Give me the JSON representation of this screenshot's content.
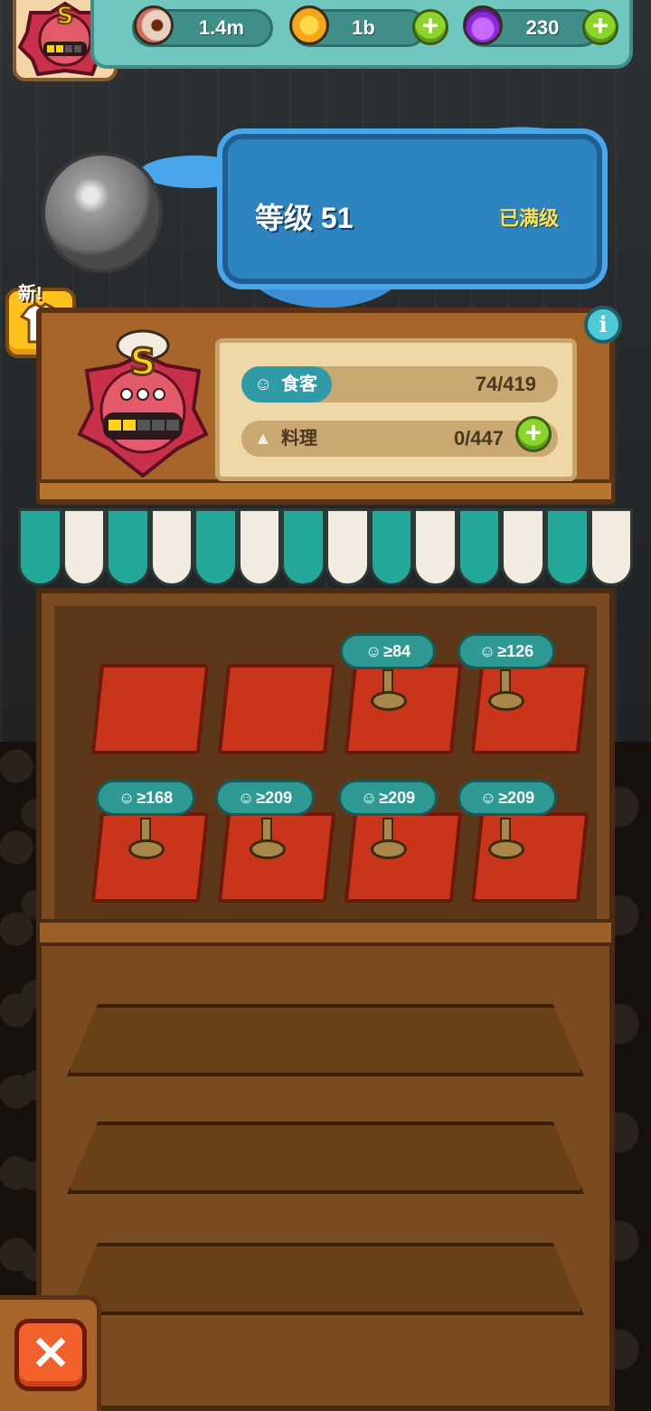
{
  "resources": {
    "eyeballs": {
      "icon": "eyeball-icon",
      "value": "1.4m"
    },
    "coins": {
      "icon": "coin-icon",
      "value": "1b"
    },
    "potions": {
      "icon": "potion-icon",
      "value": "230"
    }
  },
  "level": {
    "label": "等级 51",
    "status": "已满级"
  },
  "new_badge": "新!",
  "rank": "S",
  "stats": {
    "diners": {
      "label": "食客",
      "value": "74/419"
    },
    "dishes": {
      "label": "料理",
      "value": "0/447"
    }
  },
  "tables": {
    "row1": [
      {
        "requirement": null
      },
      {
        "requirement": null
      },
      {
        "requirement": "≥84"
      },
      {
        "requirement": "≥126"
      }
    ],
    "row2": [
      {
        "requirement": "≥168"
      },
      {
        "requirement": "≥209"
      },
      {
        "requirement": "≥209"
      },
      {
        "requirement": "≥209"
      }
    ]
  },
  "colors": {
    "teal": "#2f9a94",
    "table_red": "#c9351b",
    "plus_green": "#8bd42a",
    "level_blue": "#2d84bf",
    "max_yellow": "#ffe04a",
    "close_orange": "#f2612a"
  }
}
